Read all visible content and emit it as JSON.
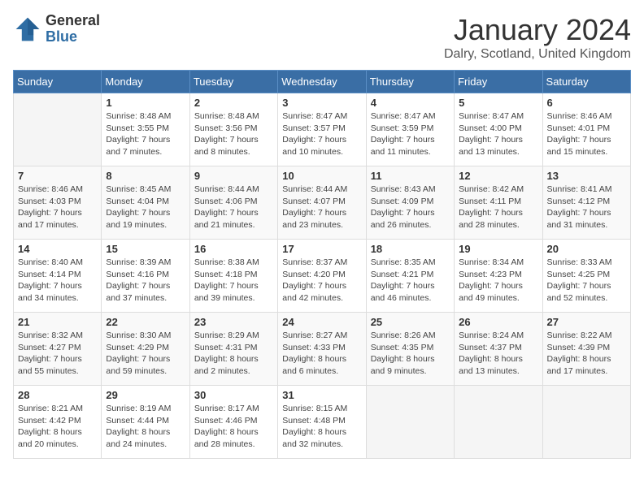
{
  "header": {
    "logo_general": "General",
    "logo_blue": "Blue",
    "month_title": "January 2024",
    "location": "Dalry, Scotland, United Kingdom"
  },
  "days_of_week": [
    "Sunday",
    "Monday",
    "Tuesday",
    "Wednesday",
    "Thursday",
    "Friday",
    "Saturday"
  ],
  "weeks": [
    [
      {
        "day": "",
        "sunrise": "",
        "sunset": "",
        "daylight": ""
      },
      {
        "day": "1",
        "sunrise": "Sunrise: 8:48 AM",
        "sunset": "Sunset: 3:55 PM",
        "daylight": "Daylight: 7 hours and 7 minutes."
      },
      {
        "day": "2",
        "sunrise": "Sunrise: 8:48 AM",
        "sunset": "Sunset: 3:56 PM",
        "daylight": "Daylight: 7 hours and 8 minutes."
      },
      {
        "day": "3",
        "sunrise": "Sunrise: 8:47 AM",
        "sunset": "Sunset: 3:57 PM",
        "daylight": "Daylight: 7 hours and 10 minutes."
      },
      {
        "day": "4",
        "sunrise": "Sunrise: 8:47 AM",
        "sunset": "Sunset: 3:59 PM",
        "daylight": "Daylight: 7 hours and 11 minutes."
      },
      {
        "day": "5",
        "sunrise": "Sunrise: 8:47 AM",
        "sunset": "Sunset: 4:00 PM",
        "daylight": "Daylight: 7 hours and 13 minutes."
      },
      {
        "day": "6",
        "sunrise": "Sunrise: 8:46 AM",
        "sunset": "Sunset: 4:01 PM",
        "daylight": "Daylight: 7 hours and 15 minutes."
      }
    ],
    [
      {
        "day": "7",
        "sunrise": "Sunrise: 8:46 AM",
        "sunset": "Sunset: 4:03 PM",
        "daylight": "Daylight: 7 hours and 17 minutes."
      },
      {
        "day": "8",
        "sunrise": "Sunrise: 8:45 AM",
        "sunset": "Sunset: 4:04 PM",
        "daylight": "Daylight: 7 hours and 19 minutes."
      },
      {
        "day": "9",
        "sunrise": "Sunrise: 8:44 AM",
        "sunset": "Sunset: 4:06 PM",
        "daylight": "Daylight: 7 hours and 21 minutes."
      },
      {
        "day": "10",
        "sunrise": "Sunrise: 8:44 AM",
        "sunset": "Sunset: 4:07 PM",
        "daylight": "Daylight: 7 hours and 23 minutes."
      },
      {
        "day": "11",
        "sunrise": "Sunrise: 8:43 AM",
        "sunset": "Sunset: 4:09 PM",
        "daylight": "Daylight: 7 hours and 26 minutes."
      },
      {
        "day": "12",
        "sunrise": "Sunrise: 8:42 AM",
        "sunset": "Sunset: 4:11 PM",
        "daylight": "Daylight: 7 hours and 28 minutes."
      },
      {
        "day": "13",
        "sunrise": "Sunrise: 8:41 AM",
        "sunset": "Sunset: 4:12 PM",
        "daylight": "Daylight: 7 hours and 31 minutes."
      }
    ],
    [
      {
        "day": "14",
        "sunrise": "Sunrise: 8:40 AM",
        "sunset": "Sunset: 4:14 PM",
        "daylight": "Daylight: 7 hours and 34 minutes."
      },
      {
        "day": "15",
        "sunrise": "Sunrise: 8:39 AM",
        "sunset": "Sunset: 4:16 PM",
        "daylight": "Daylight: 7 hours and 37 minutes."
      },
      {
        "day": "16",
        "sunrise": "Sunrise: 8:38 AM",
        "sunset": "Sunset: 4:18 PM",
        "daylight": "Daylight: 7 hours and 39 minutes."
      },
      {
        "day": "17",
        "sunrise": "Sunrise: 8:37 AM",
        "sunset": "Sunset: 4:20 PM",
        "daylight": "Daylight: 7 hours and 42 minutes."
      },
      {
        "day": "18",
        "sunrise": "Sunrise: 8:35 AM",
        "sunset": "Sunset: 4:21 PM",
        "daylight": "Daylight: 7 hours and 46 minutes."
      },
      {
        "day": "19",
        "sunrise": "Sunrise: 8:34 AM",
        "sunset": "Sunset: 4:23 PM",
        "daylight": "Daylight: 7 hours and 49 minutes."
      },
      {
        "day": "20",
        "sunrise": "Sunrise: 8:33 AM",
        "sunset": "Sunset: 4:25 PM",
        "daylight": "Daylight: 7 hours and 52 minutes."
      }
    ],
    [
      {
        "day": "21",
        "sunrise": "Sunrise: 8:32 AM",
        "sunset": "Sunset: 4:27 PM",
        "daylight": "Daylight: 7 hours and 55 minutes."
      },
      {
        "day": "22",
        "sunrise": "Sunrise: 8:30 AM",
        "sunset": "Sunset: 4:29 PM",
        "daylight": "Daylight: 7 hours and 59 minutes."
      },
      {
        "day": "23",
        "sunrise": "Sunrise: 8:29 AM",
        "sunset": "Sunset: 4:31 PM",
        "daylight": "Daylight: 8 hours and 2 minutes."
      },
      {
        "day": "24",
        "sunrise": "Sunrise: 8:27 AM",
        "sunset": "Sunset: 4:33 PM",
        "daylight": "Daylight: 8 hours and 6 minutes."
      },
      {
        "day": "25",
        "sunrise": "Sunrise: 8:26 AM",
        "sunset": "Sunset: 4:35 PM",
        "daylight": "Daylight: 8 hours and 9 minutes."
      },
      {
        "day": "26",
        "sunrise": "Sunrise: 8:24 AM",
        "sunset": "Sunset: 4:37 PM",
        "daylight": "Daylight: 8 hours and 13 minutes."
      },
      {
        "day": "27",
        "sunrise": "Sunrise: 8:22 AM",
        "sunset": "Sunset: 4:39 PM",
        "daylight": "Daylight: 8 hours and 17 minutes."
      }
    ],
    [
      {
        "day": "28",
        "sunrise": "Sunrise: 8:21 AM",
        "sunset": "Sunset: 4:42 PM",
        "daylight": "Daylight: 8 hours and 20 minutes."
      },
      {
        "day": "29",
        "sunrise": "Sunrise: 8:19 AM",
        "sunset": "Sunset: 4:44 PM",
        "daylight": "Daylight: 8 hours and 24 minutes."
      },
      {
        "day": "30",
        "sunrise": "Sunrise: 8:17 AM",
        "sunset": "Sunset: 4:46 PM",
        "daylight": "Daylight: 8 hours and 28 minutes."
      },
      {
        "day": "31",
        "sunrise": "Sunrise: 8:15 AM",
        "sunset": "Sunset: 4:48 PM",
        "daylight": "Daylight: 8 hours and 32 minutes."
      },
      {
        "day": "",
        "sunrise": "",
        "sunset": "",
        "daylight": ""
      },
      {
        "day": "",
        "sunrise": "",
        "sunset": "",
        "daylight": ""
      },
      {
        "day": "",
        "sunrise": "",
        "sunset": "",
        "daylight": ""
      }
    ]
  ]
}
